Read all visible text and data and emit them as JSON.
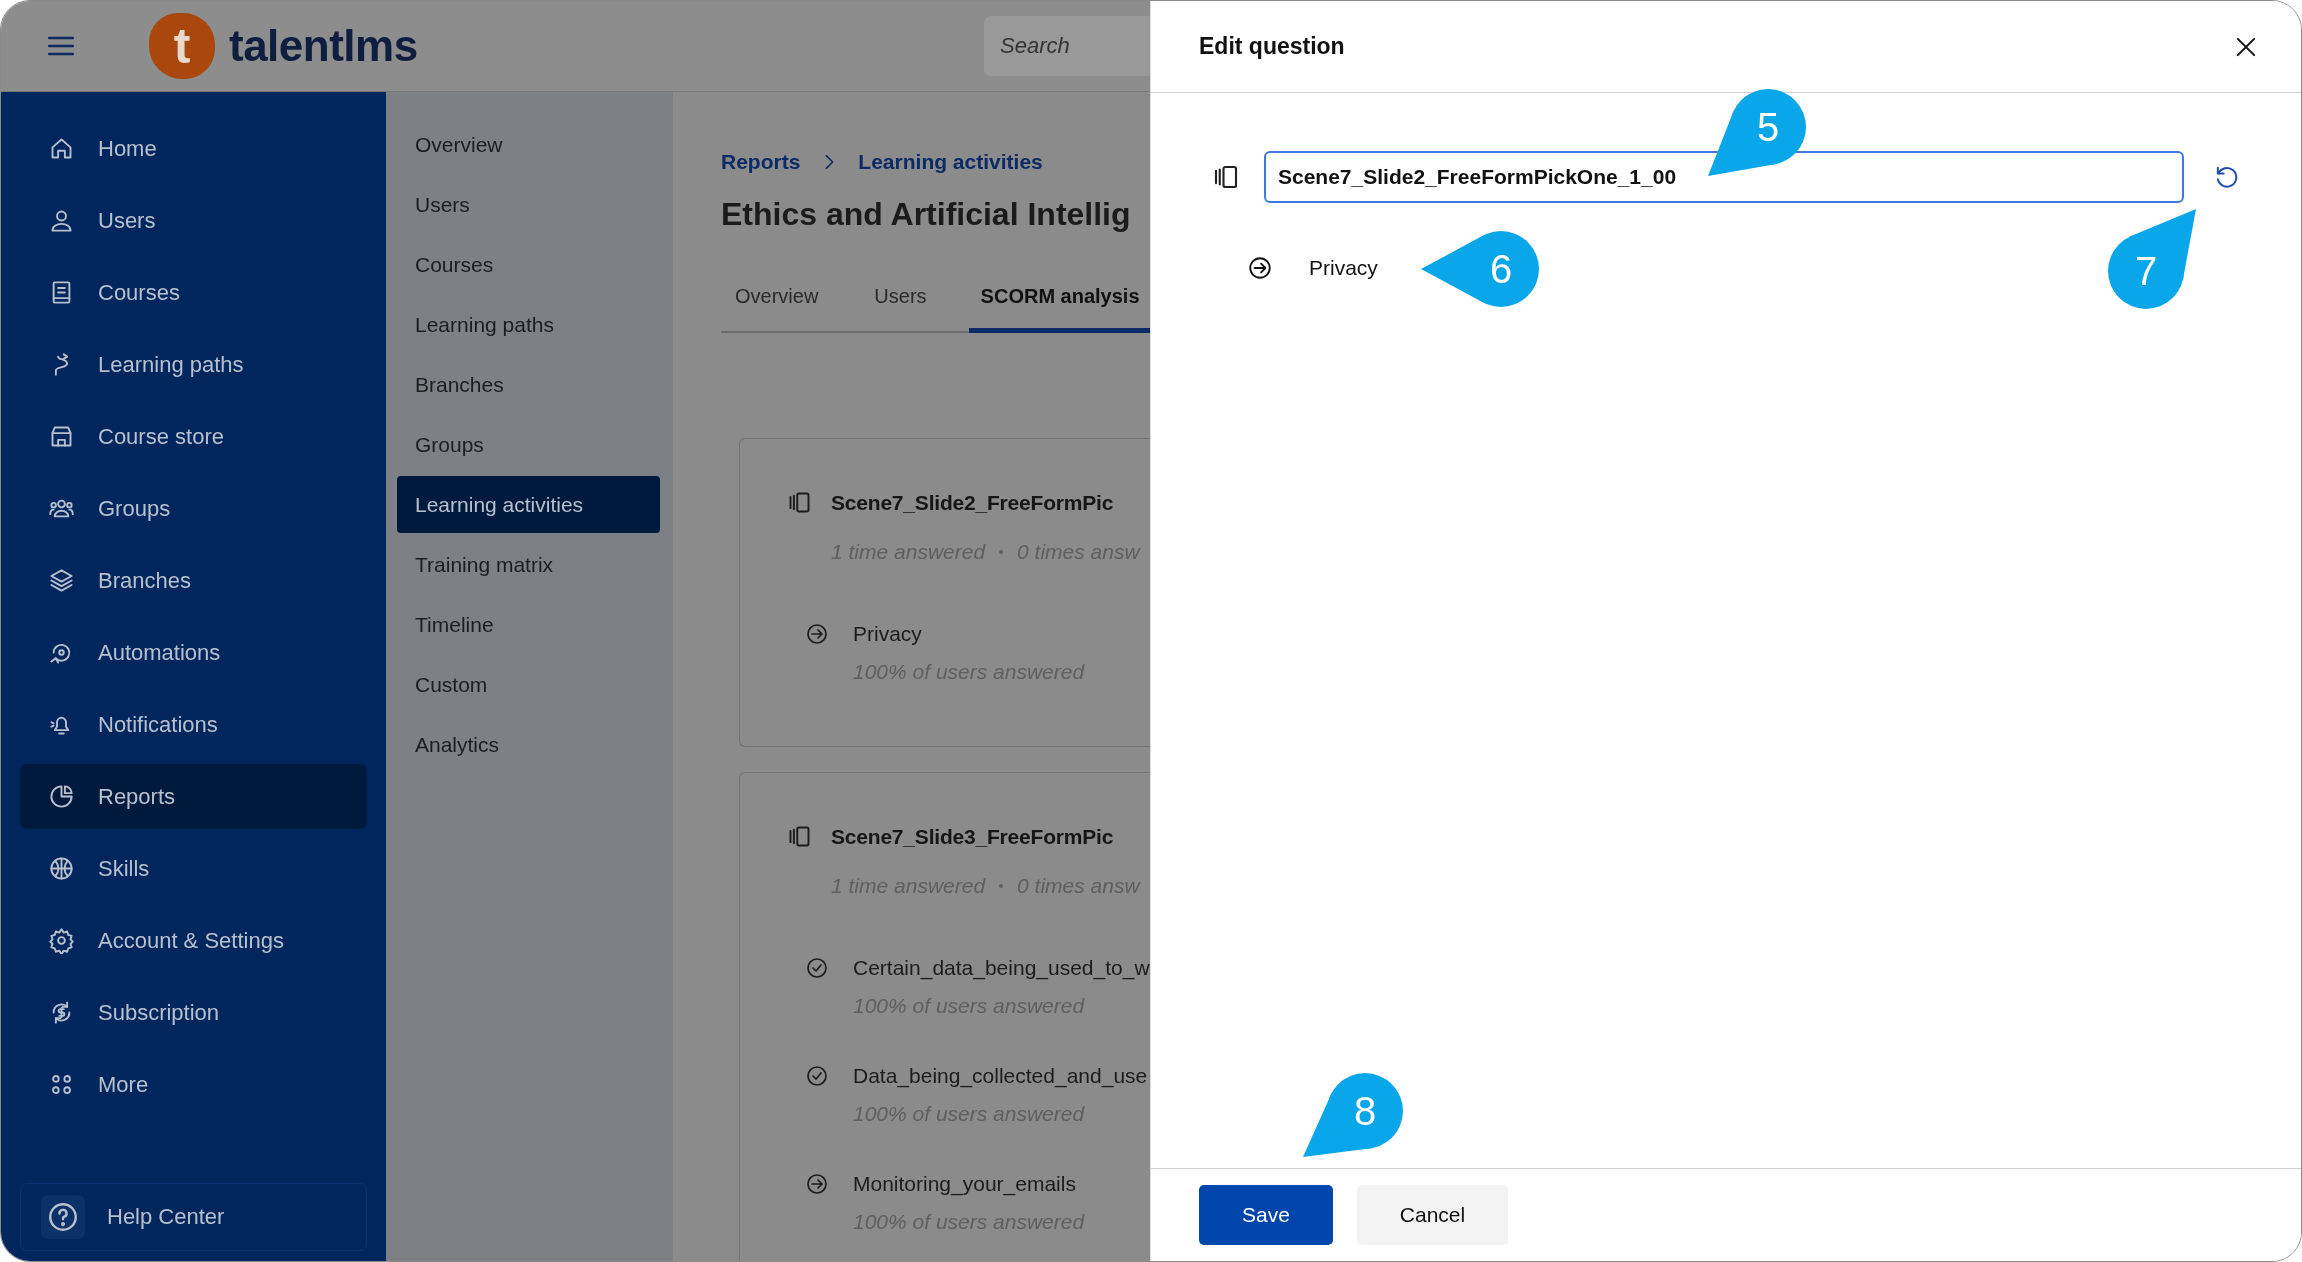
{
  "header": {
    "logo_mark": "t",
    "logo_text": "talentlms",
    "search": {
      "placeholder": "Search"
    }
  },
  "sidebar": {
    "items": [
      {
        "label": "Home",
        "selected": false
      },
      {
        "label": "Users",
        "selected": false
      },
      {
        "label": "Courses",
        "selected": false
      },
      {
        "label": "Learning paths",
        "selected": false
      },
      {
        "label": "Course store",
        "selected": false
      },
      {
        "label": "Groups",
        "selected": false
      },
      {
        "label": "Branches",
        "selected": false
      },
      {
        "label": "Automations",
        "selected": false
      },
      {
        "label": "Notifications",
        "selected": false
      },
      {
        "label": "Reports",
        "selected": true
      },
      {
        "label": "Skills",
        "selected": false
      },
      {
        "label": "Account & Settings",
        "selected": false
      },
      {
        "label": "Subscription",
        "selected": false
      },
      {
        "label": "More",
        "selected": false
      }
    ],
    "help": {
      "label": "Help Center"
    }
  },
  "submenu": {
    "items": [
      {
        "label": "Overview",
        "selected": false
      },
      {
        "label": "Users",
        "selected": false
      },
      {
        "label": "Courses",
        "selected": false
      },
      {
        "label": "Learning paths",
        "selected": false
      },
      {
        "label": "Branches",
        "selected": false
      },
      {
        "label": "Groups",
        "selected": false
      },
      {
        "label": "Learning activities",
        "selected": true
      },
      {
        "label": "Training matrix",
        "selected": false
      },
      {
        "label": "Timeline",
        "selected": false
      },
      {
        "label": "Custom",
        "selected": false
      },
      {
        "label": "Analytics",
        "selected": false
      }
    ]
  },
  "content": {
    "breadcrumb": [
      "Reports",
      "Learning activities"
    ],
    "title": "Ethics and Artificial Intellig",
    "tabs": [
      {
        "label": "Overview",
        "selected": false
      },
      {
        "label": "Users",
        "selected": false
      },
      {
        "label": "SCORM analysis",
        "selected": true
      }
    ],
    "questions": [
      {
        "title": "Scene7_Slide2_FreeFormPic",
        "stats": [
          "1 time answered",
          "0 times answ"
        ],
        "answers": [
          {
            "kind": "arrow",
            "label": "Privacy",
            "share": "100% of users answered"
          }
        ]
      },
      {
        "title": "Scene7_Slide3_FreeFormPic",
        "stats": [
          "1 time answered",
          "0 times answ"
        ],
        "answers": [
          {
            "kind": "check",
            "label": "Certain_data_being_used_to_w",
            "share": "100% of users answered"
          },
          {
            "kind": "check",
            "label": "Data_being_collected_and_use",
            "share": "100% of users answered"
          },
          {
            "kind": "arrow",
            "label": "Monitoring_your_emails",
            "share": "100% of users answered"
          }
        ]
      }
    ]
  },
  "modal": {
    "title": "Edit question",
    "question_field": {
      "value": "Scene7_Slide2_FreeFormPickOne_1_00"
    },
    "answers": [
      {
        "kind": "arrow",
        "label": "Privacy"
      }
    ],
    "buttons": [
      {
        "kind": "primary",
        "label": "Save"
      },
      {
        "kind": "secondary",
        "label": "Cancel"
      }
    ]
  },
  "callouts": [
    {
      "label": "5"
    },
    {
      "label": "6"
    },
    {
      "label": "7"
    },
    {
      "label": "8"
    }
  ]
}
